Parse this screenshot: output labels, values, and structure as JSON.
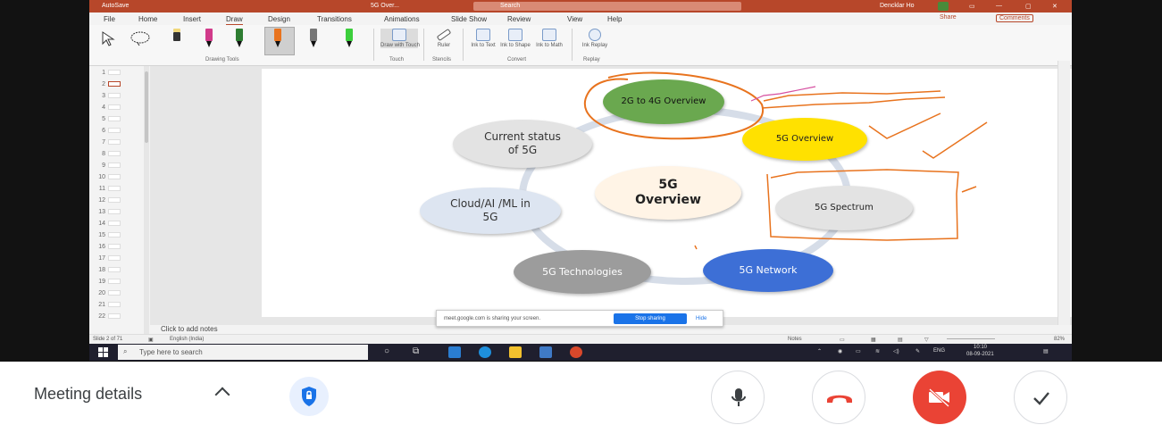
{
  "window": {
    "autosave": "AutoSave",
    "doc_title": "5G Over...",
    "search": "Search",
    "user": "Dencklar Ho",
    "share": "Share",
    "comments": "Comments"
  },
  "tabs": [
    "File",
    "Home",
    "Insert",
    "Draw",
    "Design",
    "Transitions",
    "Animations",
    "Slide Show",
    "Review",
    "View",
    "Help"
  ],
  "ribbon": {
    "drawing_tools_label": "Drawing Tools",
    "draw_touch": "Draw with Touch",
    "ruler": "Ruler",
    "ink_to_text": "Ink to Text",
    "ink_to_shape": "Ink to Shape",
    "ink_to_math": "Ink to Math",
    "ink_replay": "Ink Replay",
    "group_touch": "Touch",
    "group_stencils": "Stencils",
    "group_convert": "Convert",
    "group_replay": "Replay"
  },
  "thumbnails": [
    "1",
    "2",
    "3",
    "4",
    "5",
    "6",
    "7",
    "8",
    "9",
    "10",
    "11",
    "12",
    "13",
    "14",
    "15",
    "16",
    "17",
    "18",
    "19",
    "20",
    "21",
    "22"
  ],
  "slide": {
    "center": "5G Overview",
    "nodes": {
      "n2g4g": "2G to 4G Overview",
      "n5g": "5G Overview",
      "spectrum": "5G Spectrum",
      "network": "5G Network",
      "tech": "5G Technologies",
      "cloud": "Cloud/AI /ML in 5G",
      "status": "Current status of 5G"
    },
    "colors": {
      "green": "#6aa84f",
      "yellow": "#ffe100",
      "grey_light": "#e3e3e3",
      "blue": "#3d6fd6",
      "grey_dark": "#9c9c9c",
      "pale_blue": "#dde5f1",
      "center_fill": "#fff4e6",
      "ink": "#e8731e",
      "ink_pink": "#d64fa0"
    }
  },
  "notes": "Click to add notes",
  "status": {
    "slide_of": "Slide 2 of 71",
    "language": "English (India)",
    "notes_btn": "Notes",
    "zoom": "82%"
  },
  "share_banner": {
    "text": "meet.google.com is sharing your screen.",
    "stop": "Stop sharing",
    "hide": "Hide"
  },
  "taskbar": {
    "search_placeholder": "Type here to search",
    "time": "10:10",
    "date": "08-09-2021",
    "lang": "ENG"
  },
  "meet": {
    "meeting_details": "Meeting details"
  }
}
